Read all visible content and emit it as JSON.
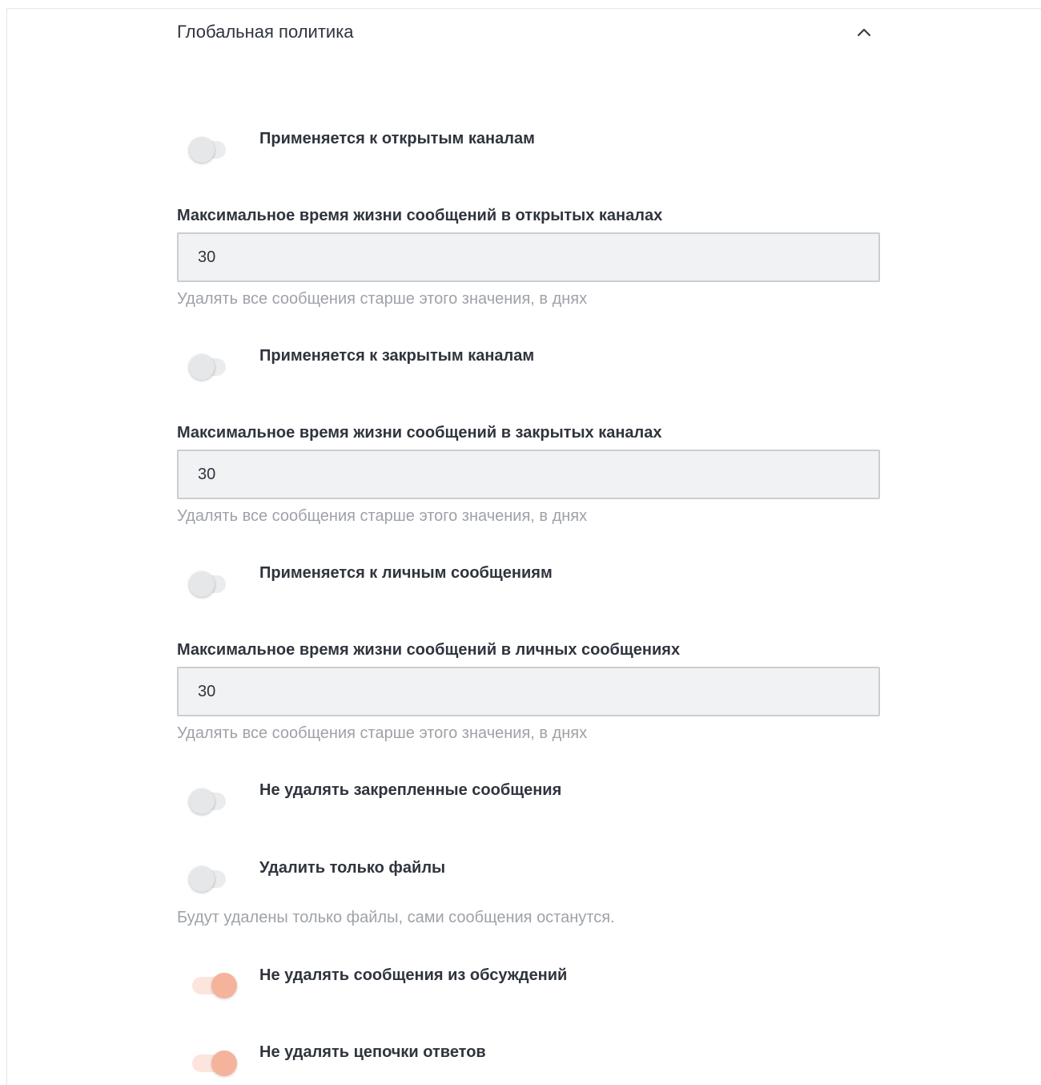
{
  "section": {
    "title": "Глобальная политика",
    "collapse_icon": "chevron-up-icon"
  },
  "toggles": {
    "public": {
      "label": "Применяется к открытым каналам",
      "checked": false
    },
    "private": {
      "label": "Применяется к закрытым каналам",
      "checked": false
    },
    "direct": {
      "label": "Применяется к личным сообщениям",
      "checked": false
    },
    "pinned": {
      "label": "Не удалять закрепленные сообщения",
      "checked": false
    },
    "files_only": {
      "label": "Удалить только файлы",
      "checked": false
    },
    "discussions": {
      "label": "Не удалять сообщения из обсуждений",
      "checked": true
    },
    "threads": {
      "label": "Не удалять цепочки ответов",
      "checked": true
    }
  },
  "fields": {
    "public_max_age": {
      "label": "Максимальное время жизни сообщений в открытых каналах",
      "value": "30",
      "hint": "Удалять все сообщения старше этого значения, в днях"
    },
    "private_max_age": {
      "label": "Максимальное время жизни сообщений в закрытых каналах",
      "value": "30",
      "hint": "Удалять все сообщения старше этого значения, в днях"
    },
    "direct_max_age": {
      "label": "Максимальное время жизни сообщений в личных сообщениях",
      "value": "30",
      "hint": "Удалять все сообщения старше этого значения, в днях"
    }
  },
  "files_only_hint": "Будут удалены только файлы, сами сообщения останутся.",
  "colors": {
    "toggle_on_knob": "#f5b39b",
    "toggle_on_track": "#fbe5dd",
    "toggle_off_knob": "#e6e7e9",
    "toggle_off_track": "#ebecee",
    "text": "#2f343d",
    "hint": "#9ea2a8",
    "input_bg": "#f1f2f4",
    "input_border": "#cbced1"
  }
}
